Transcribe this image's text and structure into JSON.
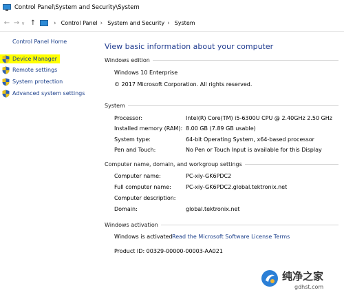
{
  "window": {
    "title": "Control Panel\\System and Security\\System"
  },
  "address": {
    "crumbs": [
      "Control Panel",
      "System and Security",
      "System"
    ]
  },
  "sidebar": {
    "home": "Control Panel Home",
    "items": [
      {
        "label": "Device Manager",
        "highlighted": true
      },
      {
        "label": "Remote settings"
      },
      {
        "label": "System protection"
      },
      {
        "label": "Advanced system settings"
      }
    ]
  },
  "main": {
    "title": "View basic information about your computer",
    "edition": {
      "heading": "Windows edition",
      "name": "Windows 10 Enterprise",
      "copyright": "© 2017 Microsoft Corporation. All rights reserved."
    },
    "system": {
      "heading": "System",
      "rows": [
        {
          "k": "Processor:",
          "v": "Intel(R) Core(TM) i5-6300U CPU @ 2.40GHz   2.50 GHz"
        },
        {
          "k": "Installed memory (RAM):",
          "v": "8.00 GB (7.89 GB usable)"
        },
        {
          "k": "System type:",
          "v": "64-bit Operating System, x64-based processor"
        },
        {
          "k": "Pen and Touch:",
          "v": "No Pen or Touch Input is available for this Display"
        }
      ]
    },
    "computer": {
      "heading": "Computer name, domain, and workgroup settings",
      "rows": [
        {
          "k": "Computer name:",
          "v": "PC-xiy-GK6PDC2"
        },
        {
          "k": "Full computer name:",
          "v": "PC-xiy-GK6PDC2.global.tektronix.net"
        },
        {
          "k": "Computer description:",
          "v": ""
        },
        {
          "k": "Domain:",
          "v": "global.tektronix.net"
        }
      ]
    },
    "activation": {
      "heading": "Windows activation",
      "status": "Windows is activated",
      "license_link": "Read the Microsoft Software License Terms",
      "product_id": "Product ID: 00329-00000-00003-AA021"
    }
  },
  "watermark": {
    "text": "纯净之家",
    "url": "gdhst.com"
  },
  "colors": {
    "link": "#1a3e8a",
    "title": "#1e3a8f",
    "highlight": "#ffff00"
  }
}
